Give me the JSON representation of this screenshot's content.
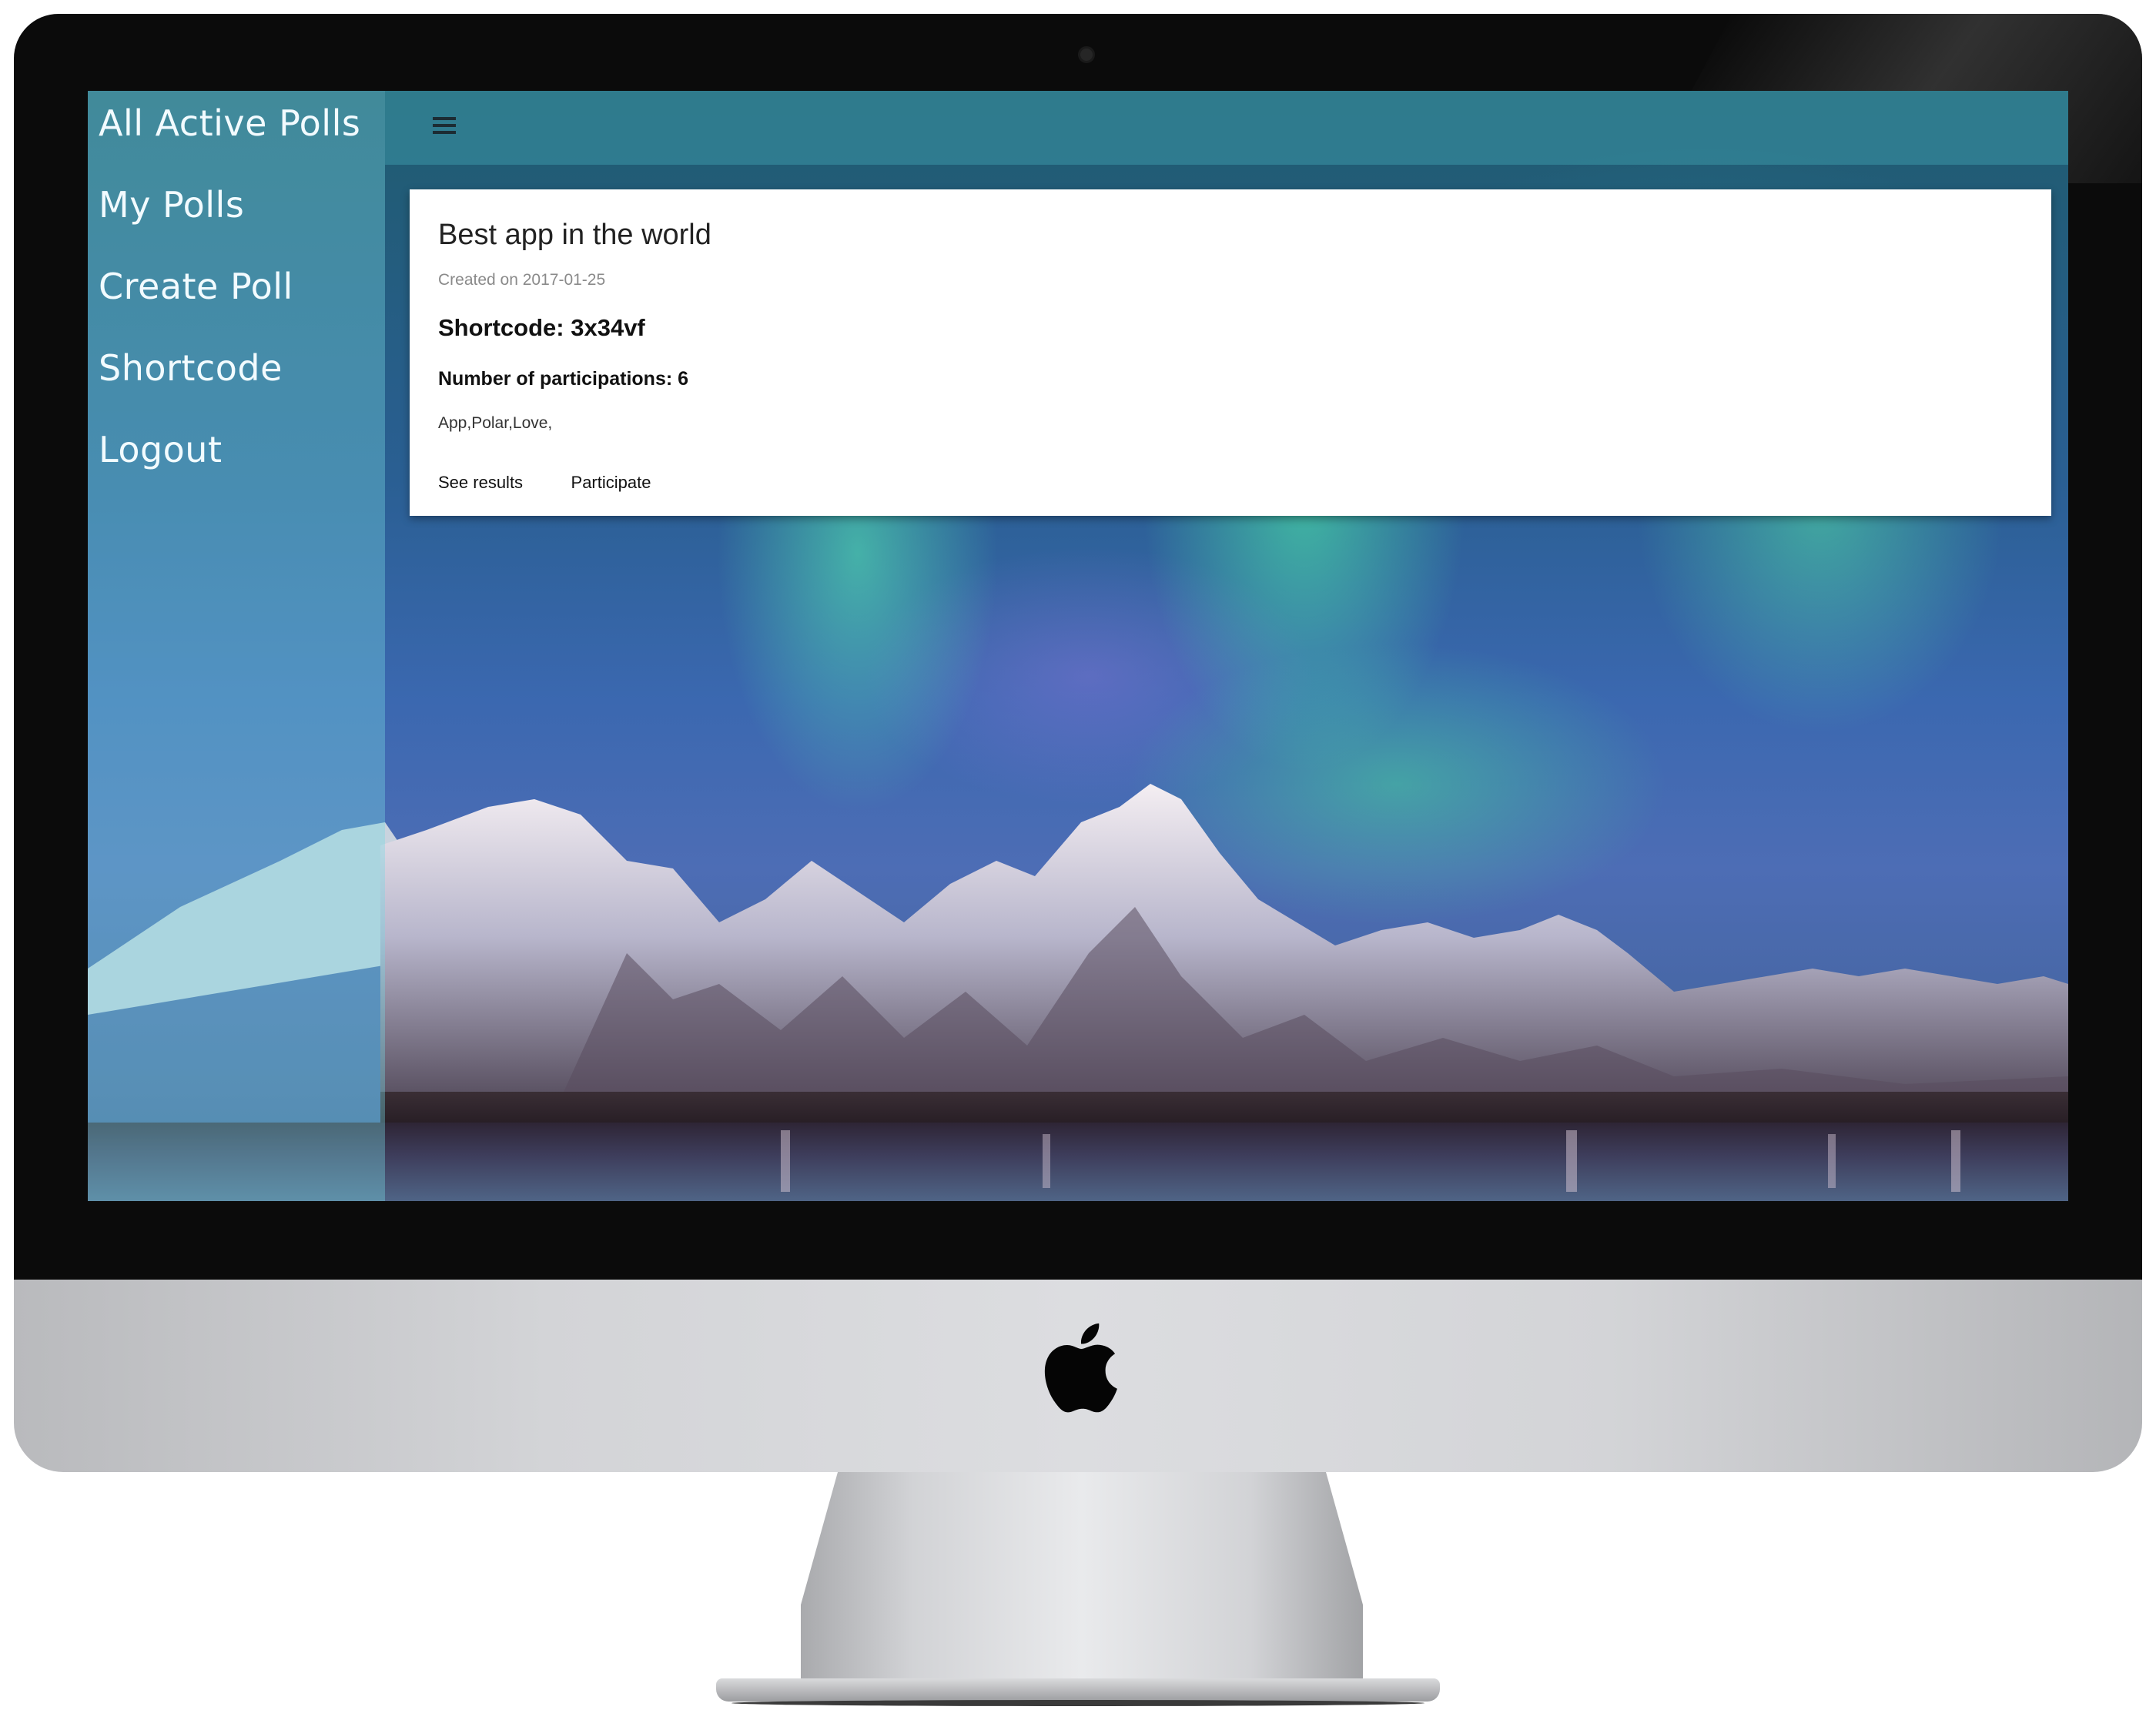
{
  "sidebar": {
    "items": [
      {
        "label": "All Active Polls"
      },
      {
        "label": "My Polls"
      },
      {
        "label": "Create Poll"
      },
      {
        "label": "Shortcode"
      },
      {
        "label": "Logout"
      }
    ]
  },
  "header": {
    "menu_icon": "hamburger-menu-icon"
  },
  "poll": {
    "title": "Best app in the world",
    "created": "Created on 2017-01-25",
    "shortcode": "Shortcode: 3x34vf",
    "participations": "Number of participations: 6",
    "tags": "App,Polar,Love,",
    "actions": {
      "see_results": "See results",
      "participate": "Participate"
    }
  },
  "device": {
    "logo_icon": "apple-logo-icon",
    "bezel_color": "#0b0b0b",
    "chin_color": "#d3d4d7"
  },
  "colors": {
    "sidebar_text": "#f2fbff",
    "card_background": "#ffffff"
  }
}
